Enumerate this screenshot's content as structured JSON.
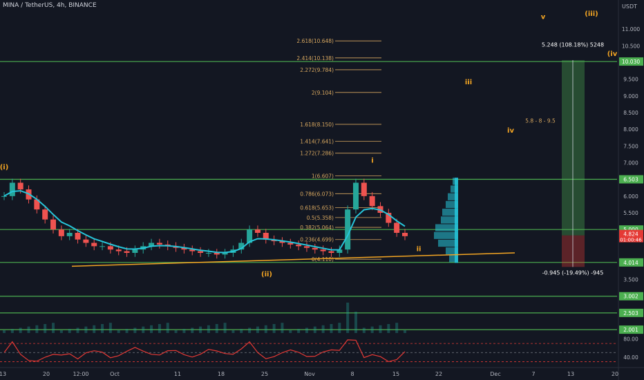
{
  "header": {
    "title": "MINA / TetherUS, 4h, BINANCE",
    "currency": "USDT"
  },
  "colors": {
    "background": "#131722",
    "green_line": "#4caf50",
    "ema": "#26c6da",
    "trendline": "#f5a623",
    "fib": "#d7a75f",
    "wave": "#f5a623",
    "rsi": "#e53935",
    "up_candle": "#26a69a",
    "down_candle": "#ef5350"
  },
  "chart_data": {
    "type": "candlestick",
    "title": "MINA / TetherUS, 4h, BINANCE",
    "y_ticks": [
      "11.000",
      "10.500",
      "10.030",
      "9.500",
      "9.000",
      "8.500",
      "8.000",
      "7.500",
      "7.000",
      "6.503",
      "6.000",
      "5.500",
      "5.000",
      "4.824",
      "4.014",
      "3.500",
      "3.002",
      "2.503",
      "2.001"
    ],
    "ylim": [
      1.9,
      11.5
    ],
    "x_ticks": [
      "13",
      "20",
      "12:00",
      "Oct",
      "11",
      "18",
      "25",
      "Nov",
      "8",
      "15",
      "22",
      "Dec",
      "7",
      "13",
      "20"
    ],
    "horizontal_levels": [
      {
        "label": "10.030",
        "value": 10.03
      },
      {
        "label": "6.503",
        "value": 6.503
      },
      {
        "label": "5.000",
        "value": 5.0
      },
      {
        "label": "4.014",
        "value": 4.014
      },
      {
        "label": "3.002",
        "value": 3.002
      },
      {
        "label": "2.503",
        "value": 2.503
      },
      {
        "label": "2.001",
        "value": 2.001
      }
    ],
    "current_price": {
      "value": "4.824",
      "countdown": "01:00:46"
    },
    "fib_levels": [
      {
        "label": "2.618(10.648)",
        "value": 10.648
      },
      {
        "label": "2.414(10.138)",
        "value": 10.138
      },
      {
        "label": "2.272(9.784)",
        "value": 9.784
      },
      {
        "label": "2(9.104)",
        "value": 9.104
      },
      {
        "label": "1.618(8.150)",
        "value": 8.15
      },
      {
        "label": "1.414(7.641)",
        "value": 7.641
      },
      {
        "label": "1.272(7.286)",
        "value": 7.286
      },
      {
        "label": "1(6.607)",
        "value": 6.607
      },
      {
        "label": "0.786(6.073)",
        "value": 6.073
      },
      {
        "label": "0.618(5.653)",
        "value": 5.653
      },
      {
        "label": "0.5(5.358)",
        "value": 5.358
      },
      {
        "label": "0.382(5.064)",
        "value": 5.064
      },
      {
        "label": "0.236(4.699)",
        "value": 4.699
      },
      {
        "label": "0(4.110)",
        "value": 4.11
      }
    ],
    "wave_labels": [
      {
        "text": "(i)",
        "x": "Sep 13",
        "y": 6.8
      },
      {
        "text": "(ii)",
        "x": "Oct 28",
        "y": 3.6
      },
      {
        "text": "i",
        "x": "Nov 9",
        "y": 7.0
      },
      {
        "text": "ii",
        "x": "Nov 16",
        "y": 4.35
      },
      {
        "text": "iii",
        "x": "Nov 25",
        "y": 9.35
      },
      {
        "text": "iv",
        "x": "Dec 2",
        "y": 7.9
      },
      {
        "text": "v",
        "x": "Dec 9",
        "y": 11.3
      },
      {
        "text": "(iii)",
        "x": "Dec 15",
        "y": 11.4
      },
      {
        "text": "(iv",
        "x": "Dec 20",
        "y": 10.2
      }
    ],
    "annotations": [
      {
        "text": "5.248 (108.18%) 5248",
        "y": 10.48
      },
      {
        "text": "-0.945 (-19.49%) -945",
        "y": 3.65
      },
      {
        "text": "5.8 - 8 - 9.5",
        "y": 8.2
      }
    ],
    "position": {
      "entry": 4.824,
      "target": 10.072,
      "stop": 3.879
    },
    "rsi_ticks": [
      "80.00",
      "40.00"
    ],
    "price_series": [
      6.0,
      6.4,
      6.2,
      5.9,
      5.6,
      5.3,
      5.0,
      4.8,
      4.9,
      4.7,
      4.6,
      4.5,
      4.5,
      4.4,
      4.35,
      4.3,
      4.4,
      4.5,
      4.6,
      4.55,
      4.5,
      4.45,
      4.4,
      4.35,
      4.3,
      4.3,
      4.25,
      4.3,
      4.4,
      4.6,
      5.0,
      4.9,
      4.7,
      4.65,
      4.6,
      4.55,
      4.5,
      4.45,
      4.4,
      4.35,
      4.3,
      4.4,
      5.6,
      6.4,
      6.0,
      5.7,
      5.5,
      5.2,
      4.9,
      4.8
    ]
  }
}
